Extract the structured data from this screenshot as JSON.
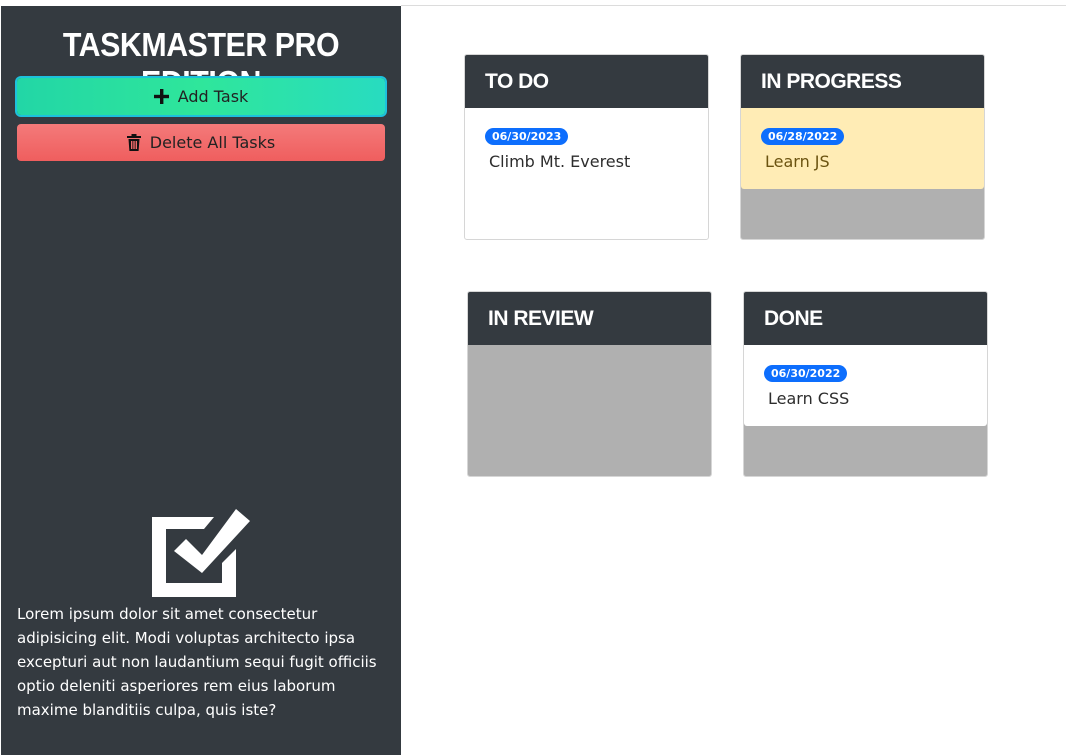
{
  "app": {
    "title": "Taskmaster Pro Edition",
    "description": "Lorem ipsum dolor sit amet consectetur adipisicing elit. Modi voluptas architecto ipsa excepturi aut non laudantium sequi fugit officiis optio deleniti asperiores rem eius laborum maxime blanditiis culpa, quis iste?"
  },
  "sidebar": {
    "add_label": "Add Task",
    "add_icon": "plus-icon",
    "delete_label": "Delete All Tasks",
    "delete_icon": "trash-icon",
    "logo_icon": "checkbox-check-icon"
  },
  "columns": {
    "todo": {
      "title": "To Do",
      "tasks": [
        {
          "date": "06/30/2023",
          "name": "Climb Mt. Everest"
        }
      ]
    },
    "in_progress": {
      "title": "In Progress",
      "tasks": [
        {
          "date": "06/28/2022",
          "name": "Learn JS",
          "status_color": "#ffecb5"
        }
      ]
    },
    "in_review": {
      "title": "In Review",
      "tasks": []
    },
    "done": {
      "title": "Done",
      "tasks": [
        {
          "date": "06/30/2022",
          "name": "Learn CSS"
        }
      ]
    }
  },
  "colors": {
    "sidebar_bg": "#343a40",
    "badge": "#0d6efd",
    "add_button": "#2fe69b",
    "delete_button": "#ef5e5e",
    "empty_column": "#b0b0b0"
  }
}
